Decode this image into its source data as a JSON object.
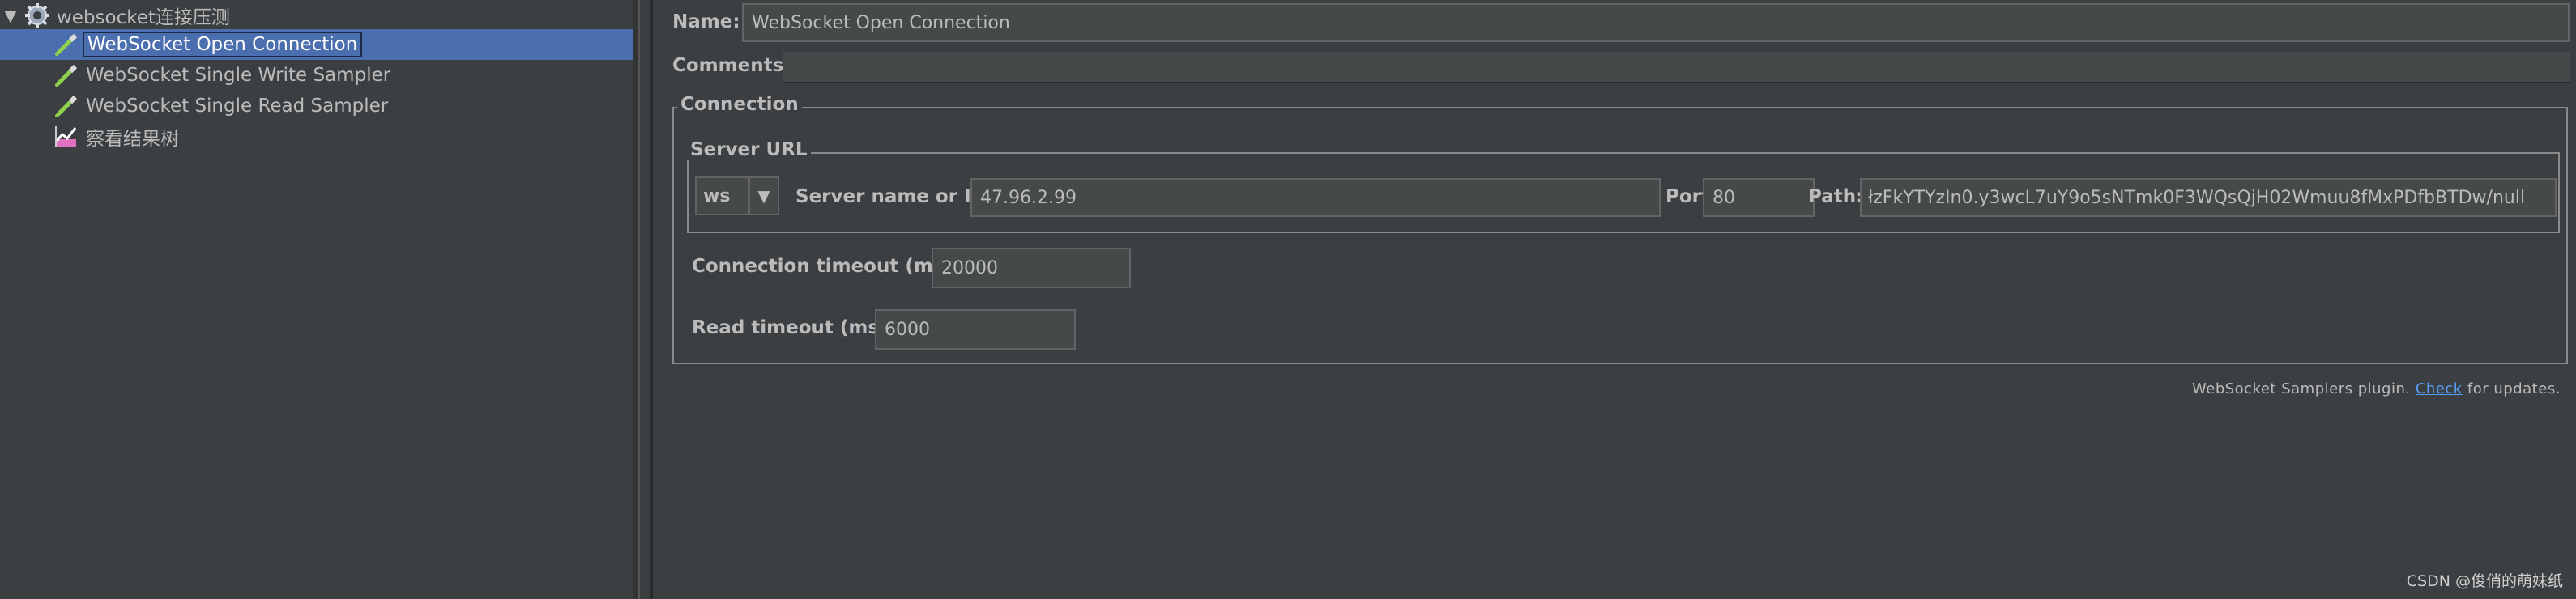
{
  "tree": {
    "root": {
      "toggle": "▼",
      "label": "websocket连接压测",
      "icon": "gear-icon"
    },
    "items": [
      {
        "label": "WebSocket Open Connection",
        "icon": "pipette-icon",
        "selected": true
      },
      {
        "label": "WebSocket Single Write Sampler",
        "icon": "pipette-icon",
        "selected": false
      },
      {
        "label": "WebSocket Single Read Sampler",
        "icon": "pipette-icon",
        "selected": false
      },
      {
        "label": "察看结果树",
        "icon": "chart-listener-icon",
        "selected": false
      }
    ]
  },
  "form": {
    "name_label": "Name:",
    "name_value": "WebSocket Open Connection",
    "comments_label": "Comments:",
    "comments_value": "",
    "connection": {
      "title": "Connection",
      "server_url": {
        "title": "Server URL",
        "protocol": "ws",
        "protocol_arrow": "▼",
        "server_label": "Server name or IP:",
        "server_value": "47.96.2.99",
        "port_label": "Port:",
        "port_value": "80",
        "path_label": "Path:",
        "path_value": "łzFkYTYzIn0.y3wcL7uY9o5sNTmk0F3WQsQjH02Wmuu8fMxPDfbBTDw/null"
      },
      "connection_timeout_label": "Connection timeout (ms):",
      "connection_timeout_value": "20000",
      "read_timeout_label": "Read timeout (ms):",
      "read_timeout_value": "6000"
    },
    "plugin_note": {
      "prefix": "WebSocket Samplers plugin. ",
      "link": "Check",
      "suffix": " for updates."
    }
  },
  "watermark": "CSDN @俊俏的萌妹纸",
  "colors": {
    "background": "#3c3f41",
    "selection": "#4b6eaf",
    "field": "#45494a",
    "link": "#589df6"
  }
}
